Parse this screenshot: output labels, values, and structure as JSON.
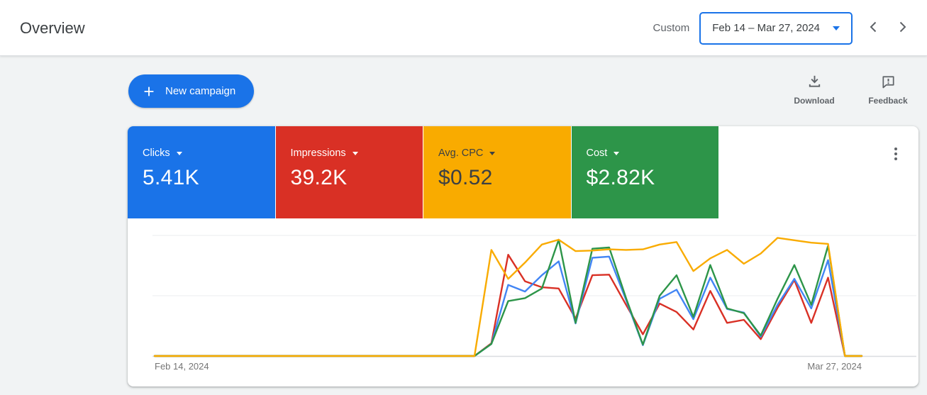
{
  "colors": {
    "accent_blue": "#1a73e8",
    "background_gray": "#f1f3f4",
    "border_gray": "#dadce0",
    "text_primary": "#3c4043",
    "text_secondary": "#5f6368"
  },
  "header": {
    "title": "Overview",
    "range_type_label": "Custom",
    "date_range_value": "Feb 14 – Mar 27, 2024"
  },
  "toolbar": {
    "new_campaign_label": "New campaign",
    "download_label": "Download",
    "feedback_label": "Feedback"
  },
  "icons": {
    "new_campaign": "plus-icon",
    "date_range": "caret-down-icon",
    "previous_period": "chevron-left-icon",
    "next_period": "chevron-right-icon",
    "download": "download-icon",
    "feedback": "feedback-bubble-icon",
    "card_menu": "kebab-menu-icon",
    "metric_dropdown": "caret-down-icon"
  },
  "scorecards": [
    {
      "label": "Clicks",
      "value": "5.41K",
      "color": "#1a73e8",
      "text_color": "#ffffff"
    },
    {
      "label": "Impressions",
      "value": "39.2K",
      "color": "#d93025",
      "text_color": "#ffffff"
    },
    {
      "label": "Avg. CPC",
      "value": "$0.52",
      "color": "#f9ab00",
      "text_color": "#3c4043"
    },
    {
      "label": "Cost",
      "value": "$2.82K",
      "color": "#2d9549",
      "text_color": "#ffffff"
    }
  ],
  "chart_data": {
    "type": "line",
    "title": "Overview performance over time",
    "x_start_label": "Feb 14, 2024",
    "x_end_label": "Mar 27, 2024",
    "x_range_days": 43,
    "grid": true,
    "legend_position": "none",
    "y_units": "normalized: 1.0 = one gridline spacing, axis unlabeled",
    "ylim": [
      0,
      2
    ],
    "series": [
      {
        "name": "Clicks",
        "color": "#4285f4",
        "values": [
          0,
          0,
          0,
          0,
          0,
          0,
          0,
          0,
          0,
          0,
          0,
          0,
          0,
          0,
          0,
          0,
          0,
          0,
          0,
          0,
          0.2,
          1.18,
          1.07,
          1.34,
          1.57,
          0.54,
          1.63,
          1.65,
          0.93,
          0.18,
          0.95,
          1.1,
          0.61,
          1.3,
          0.78,
          0.72,
          0.32,
          0.85,
          1.28,
          0.79,
          1.59,
          0,
          0
        ]
      },
      {
        "name": "Impressions",
        "color": "#d93025",
        "values": [
          0,
          0,
          0,
          0,
          0,
          0,
          0,
          0,
          0,
          0,
          0,
          0,
          0,
          0,
          0,
          0,
          0,
          0,
          0,
          0,
          0.21,
          1.68,
          1.24,
          1.14,
          1.12,
          0.62,
          1.34,
          1.35,
          0.85,
          0.36,
          0.87,
          0.73,
          0.44,
          1.08,
          0.55,
          0.6,
          0.28,
          0.8,
          1.26,
          0.55,
          1.3,
          0,
          0
        ]
      },
      {
        "name": "Avg. CPC",
        "color": "#f9ab00",
        "values": [
          0,
          0,
          0,
          0,
          0,
          0,
          0,
          0,
          0,
          0,
          0,
          0,
          0,
          0,
          0,
          0,
          0,
          0,
          0,
          0,
          1.76,
          1.28,
          1.55,
          1.85,
          1.93,
          1.74,
          1.75,
          1.77,
          1.76,
          1.77,
          1.85,
          1.89,
          1.41,
          1.62,
          1.76,
          1.53,
          1.7,
          1.96,
          1.92,
          1.88,
          1.86,
          0,
          0
        ]
      },
      {
        "name": "Cost",
        "color": "#2d9549",
        "values": [
          0,
          0,
          0,
          0,
          0,
          0,
          0,
          0,
          0,
          0,
          0,
          0,
          0,
          0,
          0,
          0,
          0,
          0,
          0,
          0,
          0.2,
          0.91,
          0.96,
          1.12,
          1.93,
          0.55,
          1.78,
          1.8,
          0.96,
          0.19,
          1,
          1.34,
          0.65,
          1.51,
          0.79,
          0.71,
          0.34,
          0.95,
          1.51,
          0.85,
          1.83,
          0,
          0
        ]
      }
    ],
    "draw_order": [
      1,
      0,
      3,
      2
    ]
  }
}
